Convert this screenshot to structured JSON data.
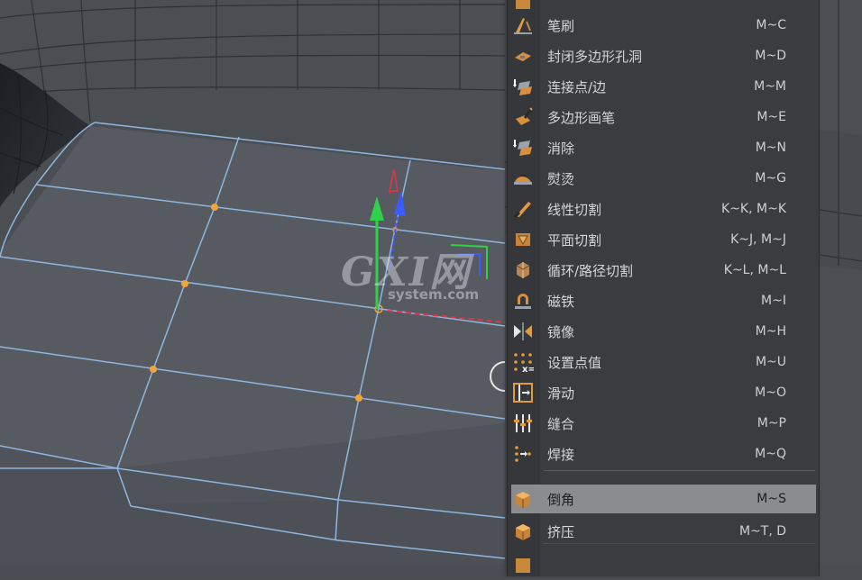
{
  "watermark": {
    "logo": "GXI网",
    "site": "system.com"
  },
  "menu": {
    "items": [
      {
        "label": "笔刷",
        "shortcut": "M~C",
        "icon": "brush-icon"
      },
      {
        "label": "封闭多边形孔洞",
        "shortcut": "M~D",
        "icon": "close-hole-icon"
      },
      {
        "label": "连接点/边",
        "shortcut": "M~M",
        "icon": "connect-points-icon"
      },
      {
        "label": "多边形画笔",
        "shortcut": "M~E",
        "icon": "polygon-pen-icon"
      },
      {
        "label": "消除",
        "shortcut": "M~N",
        "icon": "dissolve-icon"
      },
      {
        "label": "熨烫",
        "shortcut": "M~G",
        "icon": "iron-icon"
      },
      {
        "label": "线性切割",
        "shortcut": "K~K, M~K",
        "icon": "knife-icon"
      },
      {
        "label": "平面切割",
        "shortcut": "K~J, M~J",
        "icon": "plane-cut-icon"
      },
      {
        "label": "循环/路径切割",
        "shortcut": "K~L, M~L",
        "icon": "loop-cut-icon"
      },
      {
        "label": "磁铁",
        "shortcut": "M~I",
        "icon": "magnet-icon"
      },
      {
        "label": "镜像",
        "shortcut": "M~H",
        "icon": "mirror-icon"
      },
      {
        "label": "设置点值",
        "shortcut": "M~U",
        "icon": "set-point-value-icon"
      },
      {
        "label": "滑动",
        "shortcut": "M~O",
        "icon": "slide-icon"
      },
      {
        "label": "缝合",
        "shortcut": "M~P",
        "icon": "stitch-icon"
      },
      {
        "label": "焊接",
        "shortcut": "M~Q",
        "icon": "weld-icon"
      },
      {
        "label": "倒角",
        "shortcut": "M~S",
        "icon": "bevel-icon",
        "active": true
      },
      {
        "label": "挤压",
        "shortcut": "M~T, D",
        "icon": "extrude-icon"
      }
    ]
  },
  "colors": {
    "viewport_bg": "#4a4d52",
    "edge": "#8fb6e0",
    "point": "#f2a53a",
    "menu_bg": "#3b3c3e",
    "menu_active": "#8b8c8e",
    "axis_y": "#2fd04a",
    "axis_z": "#3a5cff",
    "axis_x": "#e0354a"
  }
}
